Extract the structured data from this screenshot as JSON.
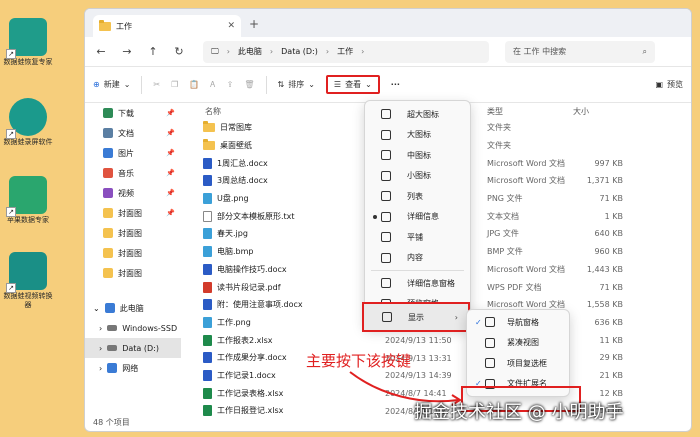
{
  "desktop": {
    "icons": [
      {
        "caption": "数据蛙恢复专家",
        "color": "#1f9c8a"
      },
      {
        "caption": "数据蛙录屏软件",
        "color": "#1b9a8c"
      },
      {
        "caption": "苹果数据专家",
        "color": "#2aa66e"
      },
      {
        "caption": "数据蛙视频转换器",
        "color": "#1a8f86"
      }
    ]
  },
  "window": {
    "tab_title": "工作",
    "address": {
      "segments": [
        "此电脑",
        "Data (D:)",
        "工作"
      ]
    },
    "search_placeholder": "在 工作 中搜索"
  },
  "toolbar": {
    "new_label": "新建",
    "sort_label": "排序",
    "view_label": "查看",
    "more_label": "···",
    "preview_label": "预览"
  },
  "sidebar": {
    "quick": [
      {
        "label": "下载",
        "pin": true,
        "color": "#2e8b57"
      },
      {
        "label": "文档",
        "pin": true,
        "color": "#5b7fa3"
      },
      {
        "label": "图片",
        "pin": true,
        "color": "#3a7bd5"
      },
      {
        "label": "音乐",
        "pin": true,
        "color": "#e0533f"
      },
      {
        "label": "视频",
        "pin": true,
        "color": "#8a4fbf"
      },
      {
        "label": "封面图",
        "pin": true,
        "color": "#f4c24f"
      },
      {
        "label": "封面图",
        "pin": false,
        "color": "#f4c24f"
      },
      {
        "label": "封面图",
        "pin": false,
        "color": "#f4c24f"
      },
      {
        "label": "封面图",
        "pin": false,
        "color": "#f4c24f"
      }
    ],
    "pc_label": "此电脑",
    "drives": [
      {
        "label": "Windows-SSD",
        "selected": false
      },
      {
        "label": "Data (D:)",
        "selected": true
      }
    ],
    "network_label": "网络"
  },
  "columns": {
    "name": "名称",
    "type": "类型",
    "size": "大小"
  },
  "files": [
    {
      "name": "日常图库",
      "kind": "fold"
    },
    {
      "name": "桌面壁纸",
      "kind": "fold"
    },
    {
      "name": "1周汇总.docx",
      "kind": "word"
    },
    {
      "name": "3周总结.docx",
      "kind": "word"
    },
    {
      "name": "U盘.png",
      "kind": "img"
    },
    {
      "name": "部分文本模板原形.txt",
      "kind": "txt"
    },
    {
      "name": "春天.jpg",
      "kind": "img"
    },
    {
      "name": "电脑.bmp",
      "kind": "img"
    },
    {
      "name": "电脑操作技巧.docx",
      "kind": "word"
    },
    {
      "name": "读书片段记录.pdf",
      "kind": "pdf"
    },
    {
      "name": "附：使用注意事项.docx",
      "kind": "word"
    },
    {
      "name": "工作.png",
      "kind": "img"
    },
    {
      "name": "工作报表2.xlsx",
      "kind": "xls"
    },
    {
      "name": "工作成果分享.docx",
      "kind": "word"
    },
    {
      "name": "工作记录1.docx",
      "kind": "word"
    },
    {
      "name": "工作记录表格.xlsx",
      "kind": "xls"
    },
    {
      "name": "工作日报登记.xlsx",
      "kind": "xls"
    }
  ],
  "right_rows": [
    {
      "type": "文件夹",
      "size": ""
    },
    {
      "type": "文件夹",
      "size": ""
    },
    {
      "type": "Microsoft Word 文档",
      "size": "997 KB"
    },
    {
      "type": "Microsoft Word 文档",
      "size": "1,371 KB"
    },
    {
      "type": "PNG 文件",
      "size": "71 KB"
    },
    {
      "type": "文本文档",
      "size": "1 KB"
    },
    {
      "type": "JPG 文件",
      "size": "640 KB"
    },
    {
      "type": "BMP 文件",
      "size": "960 KB"
    },
    {
      "type": "Microsoft Word 文档",
      "size": "1,443 KB"
    },
    {
      "type": "WPS PDF 文档",
      "size": "71 KB"
    },
    {
      "type": "Microsoft Word 文档",
      "size": "1,558 KB"
    },
    {
      "type": "",
      "size": "636 KB"
    },
    {
      "type": "",
      "size": "11 KB"
    },
    {
      "type": "",
      "size": "29 KB"
    },
    {
      "type": "",
      "size": "21 KB"
    },
    {
      "type": "",
      "size": "12 KB"
    },
    {
      "type": "",
      "size": "10 KB"
    }
  ],
  "dates": [
    "2024/9/13 11:50",
    "2024/9/13 13:31",
    "2024/9/13 14:39",
    "2024/8/7 14:41",
    "2024/8/13 11:??"
  ],
  "status": "48 个项目",
  "view_menu": {
    "items": [
      {
        "label": "超大图标",
        "dot": false
      },
      {
        "label": "大图标",
        "dot": false
      },
      {
        "label": "中图标",
        "dot": false
      },
      {
        "label": "小图标",
        "dot": false
      },
      {
        "label": "列表",
        "dot": false
      },
      {
        "label": "详细信息",
        "dot": true
      },
      {
        "label": "平铺",
        "dot": false
      },
      {
        "label": "内容",
        "dot": false
      }
    ],
    "extra": [
      {
        "label": "详细信息窗格",
        "dot": false
      },
      {
        "label": "预览窗格",
        "dot": true
      }
    ],
    "show_label": "显示"
  },
  "show_submenu": [
    {
      "label": "导航窗格",
      "checked": true
    },
    {
      "label": "紧凑视图",
      "checked": false
    },
    {
      "label": "项目复选框",
      "checked": false
    },
    {
      "label": "文件扩展名",
      "checked": true
    }
  ],
  "annotation": "主要按下该按键",
  "watermark": "掘金技术社区 @ 小明助手",
  "colors": {
    "highlight": "#e02020",
    "accent": "#2a6fdb",
    "desktop_bg": "#f6ce7c"
  }
}
